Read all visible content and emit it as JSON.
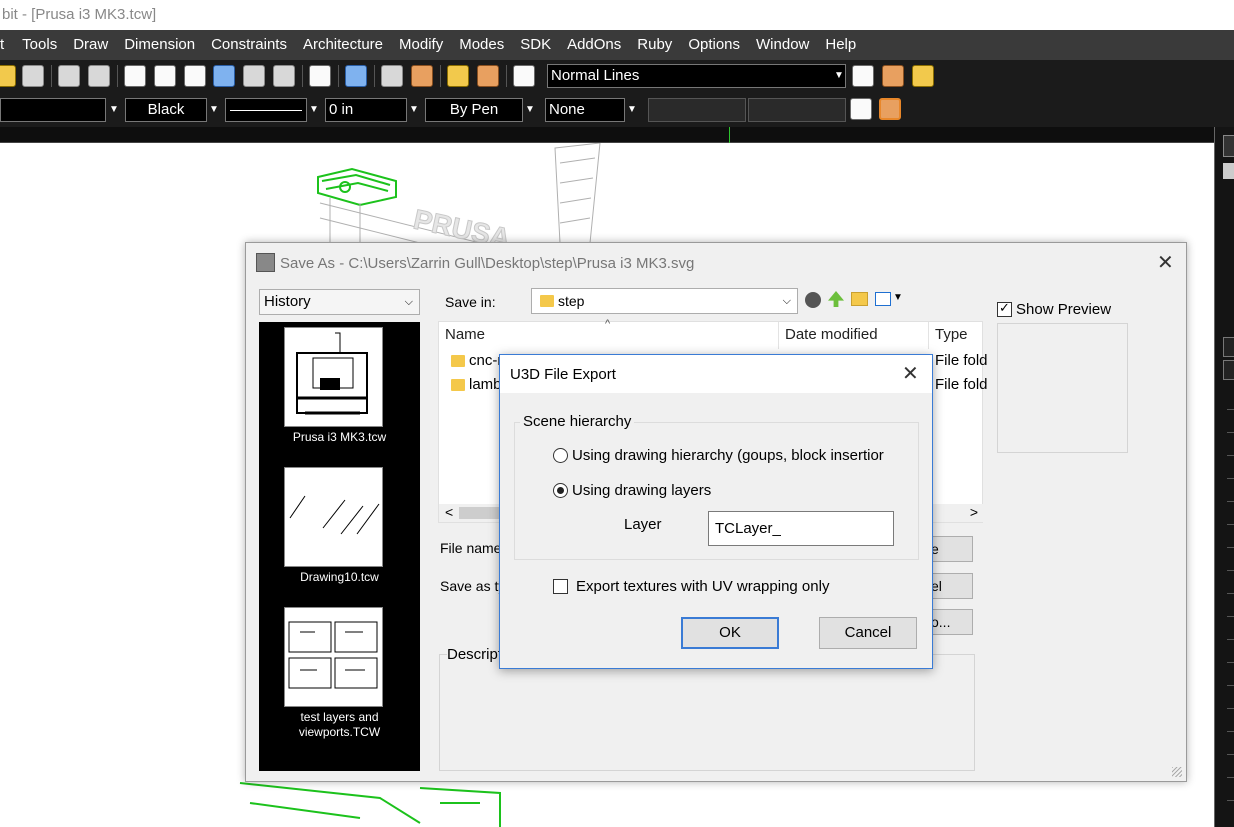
{
  "window": {
    "title": "bit - [Prusa i3 MK3.tcw]"
  },
  "menubar": {
    "items": [
      "t",
      "Tools",
      "Draw",
      "Dimension",
      "Constraints",
      "Architecture",
      "Modify",
      "Modes",
      "SDK",
      "AddOns",
      "Ruby",
      "Options",
      "Window",
      "Help"
    ]
  },
  "toolbar": {
    "line_style_value": "Normal Lines",
    "color_value": "Black",
    "width_value": "0 in",
    "pen_value": "By Pen",
    "fill_value": "None"
  },
  "canvas": {
    "watermark_text": "PRUSA"
  },
  "save_as": {
    "title": "Save As - C:\\Users\\Zarrin Gull\\Desktop\\step\\Prusa i3 MK3.svg",
    "history_label": "History",
    "save_in_label": "Save in:",
    "save_in_value": "step",
    "columns": {
      "name": "Name",
      "date": "Date modified",
      "type": "Type"
    },
    "rows": [
      {
        "name": "cnc-r",
        "type": "File fold"
      },
      {
        "name": "lamb",
        "type": "File fold"
      }
    ],
    "file_name_label": "File name",
    "save_as_type_label": "Save as ty",
    "description_label": "Descript",
    "save_button_fragment": "e",
    "cancel_button_fragment": "el",
    "options_button_fragment": "o...",
    "show_preview_label": "Show Preview",
    "show_preview_checked": true,
    "history": [
      {
        "label": "Prusa i3 MK3.tcw"
      },
      {
        "label": "Drawing10.tcw"
      },
      {
        "label": "test layers and",
        "label2": "viewports.TCW"
      }
    ]
  },
  "u3d": {
    "title": "U3D File Export",
    "group_label": "Scene hierarchy",
    "option_hierarchy": "Using drawing hierarchy (goups, block insertior",
    "option_layers": "Using drawing layers",
    "selected_option": "layers",
    "layer_label": "Layer",
    "layer_value": "TCLayer_",
    "export_textures_label": "Export textures with UV wrapping only",
    "export_textures_checked": false,
    "ok_label": "OK",
    "cancel_label": "Cancel"
  },
  "colors": {
    "menubar_bg": "#3a3a3a",
    "toolbar_bg": "#1b1b1b",
    "accent": "#3a7bd5",
    "model_green": "#1cc21c"
  }
}
